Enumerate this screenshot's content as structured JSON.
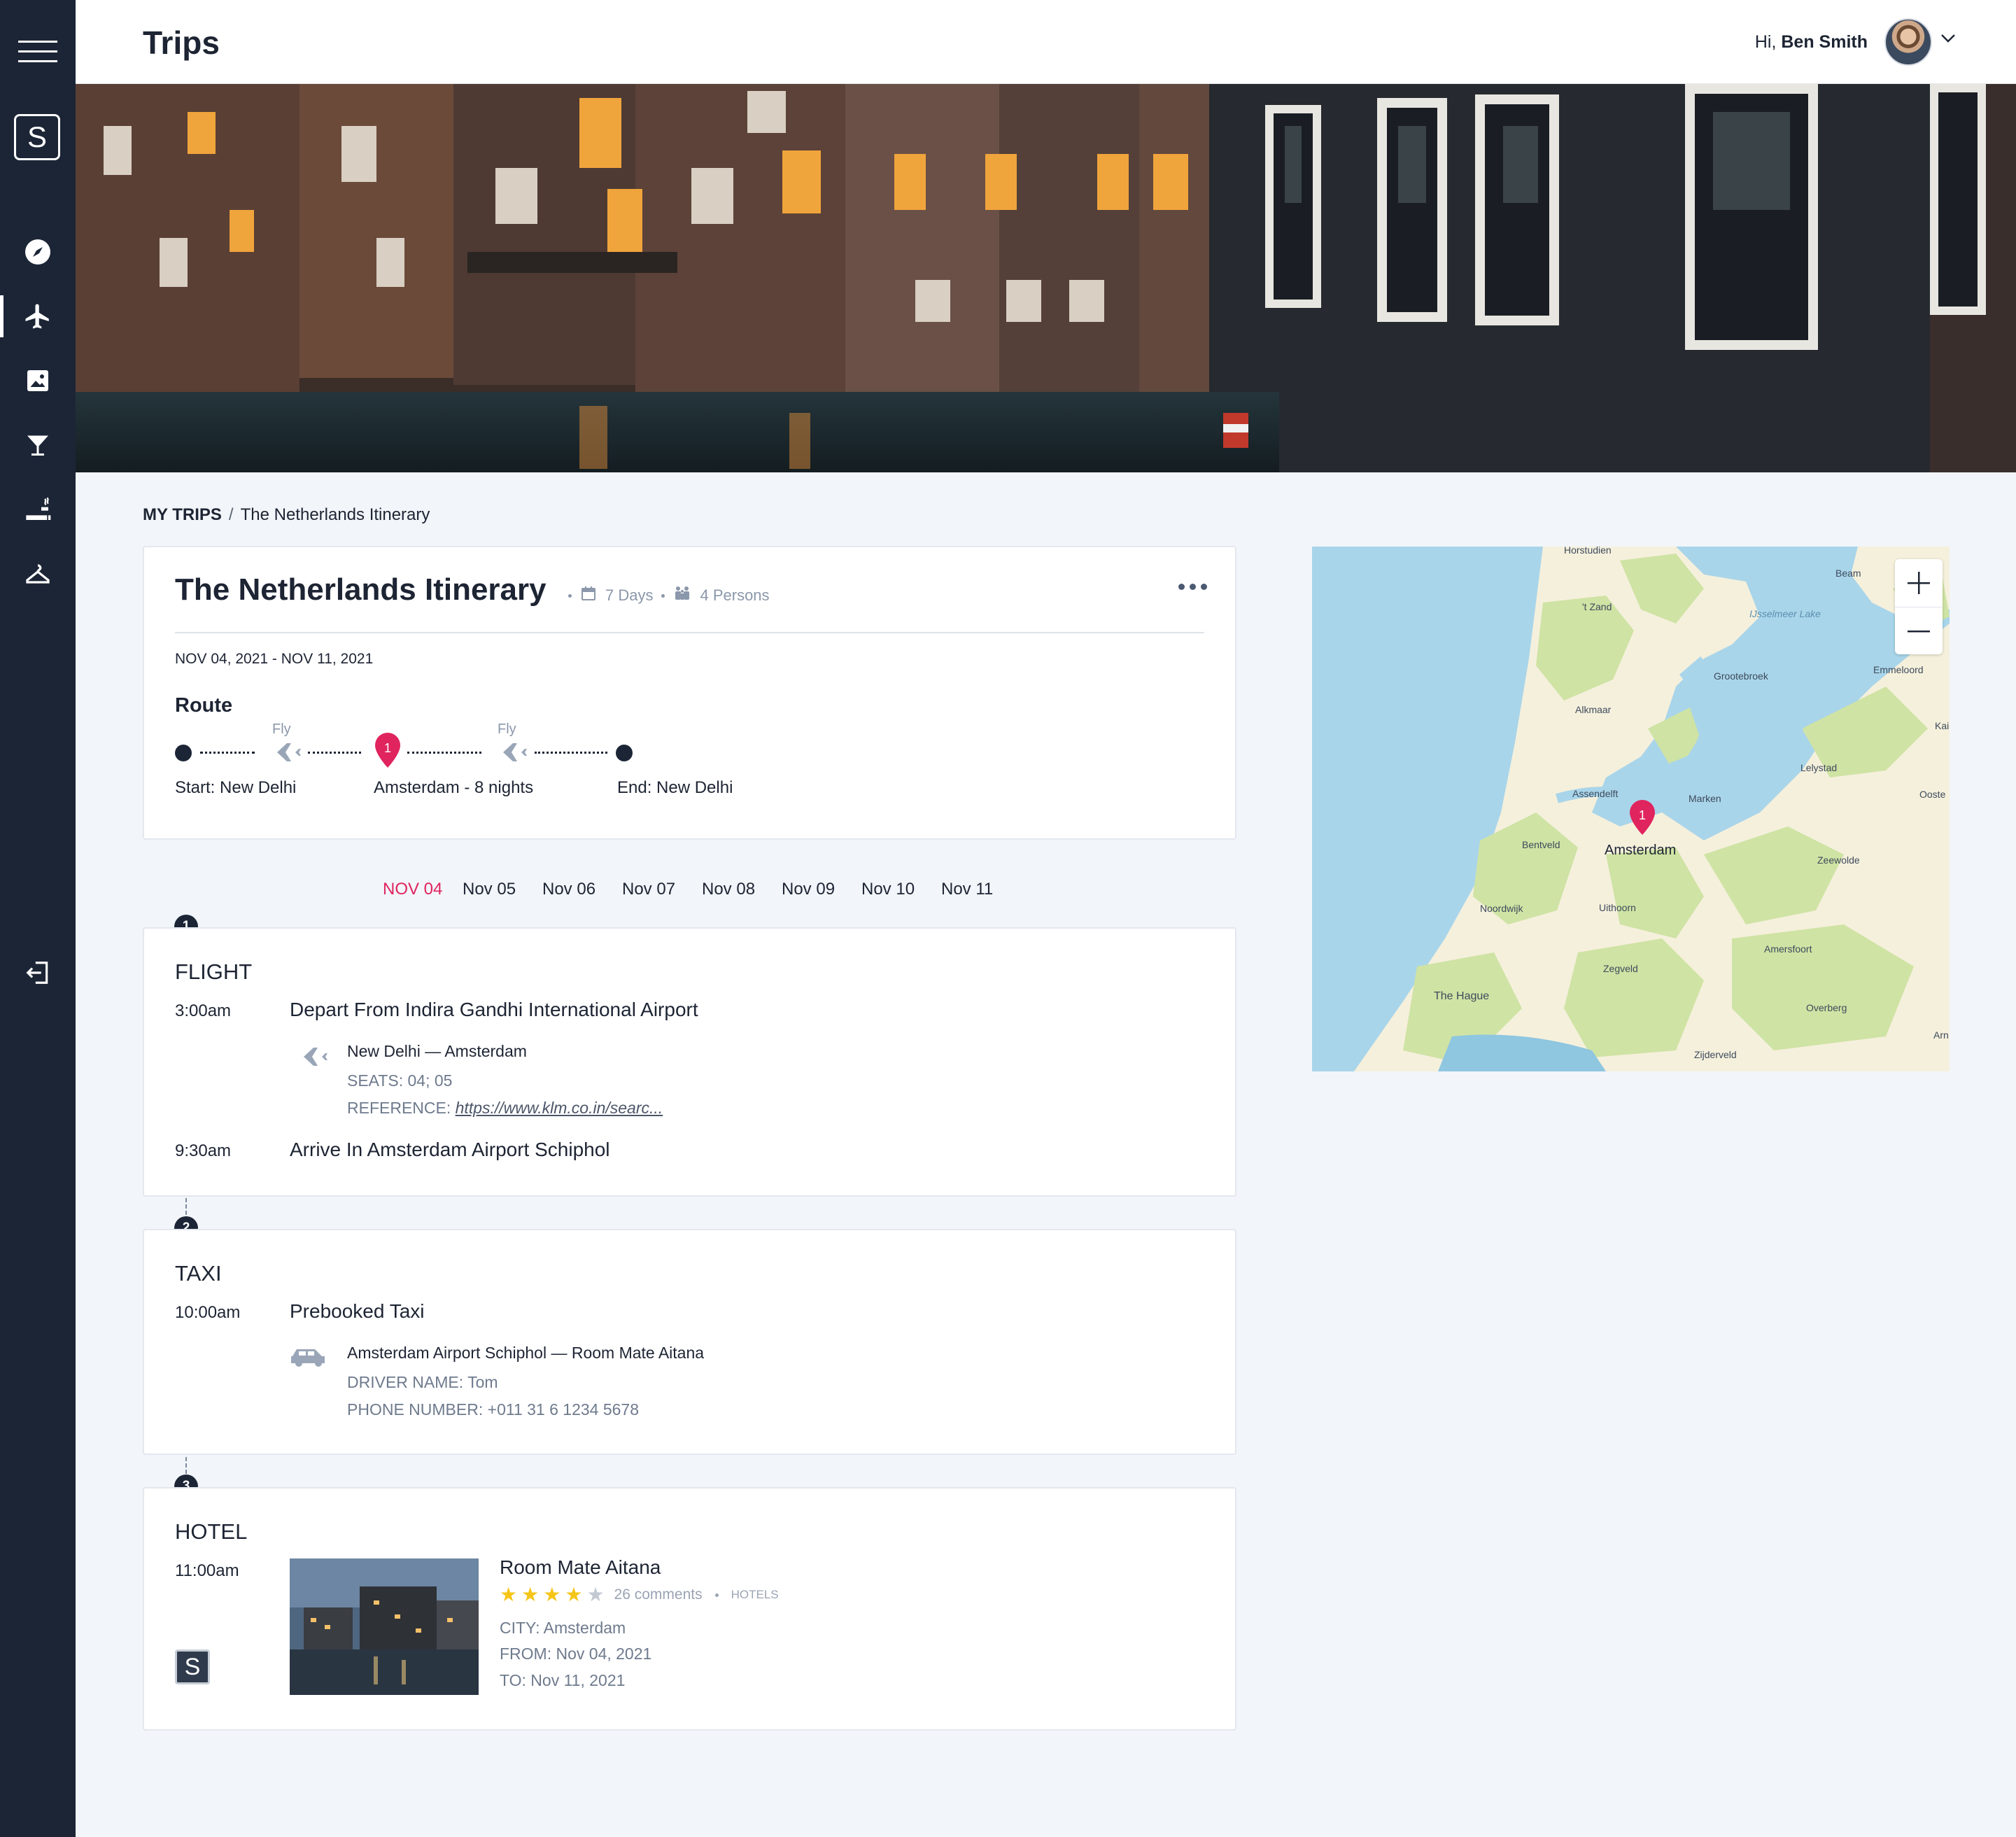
{
  "header": {
    "title": "Trips",
    "greeting_prefix": "Hi,",
    "user_name": "Ben Smith"
  },
  "sidebar": {
    "logo_letter": "S",
    "items": [
      {
        "name": "menu",
        "icon": "hamburger-icon"
      },
      {
        "name": "explore",
        "icon": "compass-icon"
      },
      {
        "name": "trips",
        "icon": "plane-icon",
        "active": true
      },
      {
        "name": "photos",
        "icon": "image-icon"
      },
      {
        "name": "nightlife",
        "icon": "cocktail-icon"
      },
      {
        "name": "relax",
        "icon": "spa-icon"
      },
      {
        "name": "wardrobe",
        "icon": "hanger-icon"
      },
      {
        "name": "logout",
        "icon": "logout-icon"
      }
    ]
  },
  "breadcrumb": {
    "root": "MY TRIPS",
    "separator": "/",
    "current": "The Netherlands Itinerary"
  },
  "trip": {
    "title": "The Netherlands Itinerary",
    "days": "7 Days",
    "persons": "4 Persons",
    "dates": "NOV 04, 2021 - NOV 11, 2021",
    "route_label": "Route",
    "route": {
      "start": "Start: New Delhi",
      "stop_number": "1",
      "stop": "Amsterdam - 8 nights",
      "end": "End: New Delhi",
      "leg1_mode": "Fly",
      "leg2_mode": "Fly"
    }
  },
  "day_tabs": [
    "NOV 04",
    "Nov 05",
    "Nov 06",
    "Nov 07",
    "Nov 08",
    "Nov 09",
    "Nov 10",
    "Nov 11"
  ],
  "active_day": "NOV 04",
  "timeline": {
    "flight": {
      "step": "1",
      "title": "FLIGHT",
      "depart_time": "3:00am",
      "depart_event": "Depart From Indira Gandhi International Airport",
      "route": "New Delhi — Amsterdam",
      "seats": "SEATS: 04; 05",
      "reference_label": "REFERENCE:",
      "reference_link": "https://www.klm.co.in/searc...",
      "arrive_time": "9:30am",
      "arrive_event": "Arrive In Amsterdam Airport Schiphol"
    },
    "taxi": {
      "step": "2",
      "title": "TAXI",
      "time": "10:00am",
      "event": "Prebooked Taxi",
      "route": "Amsterdam Airport Schiphol — Room Mate Aitana",
      "driver": "DRIVER NAME: Tom",
      "phone": "PHONE NUMBER: +011 31 6 1234 5678"
    },
    "hotel": {
      "step": "3",
      "title": "HOTEL",
      "time": "11:00am",
      "name": "Room Mate Aitana",
      "rating": 4,
      "max_rating": 5,
      "comments": "26 comments",
      "category": "HOTELS",
      "city": "CITY: Amsterdam",
      "from": "FROM: Nov 04, 2021",
      "to": "TO: Nov 11, 2021",
      "badge_letter": "S"
    }
  },
  "map": {
    "pin_number": "1",
    "labels": [
      "Amsterdam",
      "Alkmaar",
      "'t Zand",
      "Beam",
      "Grootebroek",
      "Emmeloord",
      "IJsselmeer Lake",
      "Lelystad",
      "Marken",
      "Assendelft",
      "Bentveld",
      "Noordwijk",
      "Uithoorn",
      "Zeewolde",
      "Amersfoort",
      "Zegveld",
      "The Hague",
      "Overberg",
      "Zijderveld",
      "Kai",
      "Ooste",
      "Arn",
      "Horstudien"
    ]
  },
  "colors": {
    "sidebar": "#1c2536",
    "accent": "#e0245e",
    "star": "#f5c518",
    "water": "#a9d5ea",
    "land": "#f5f0dc",
    "green": "#cfe3a4"
  }
}
